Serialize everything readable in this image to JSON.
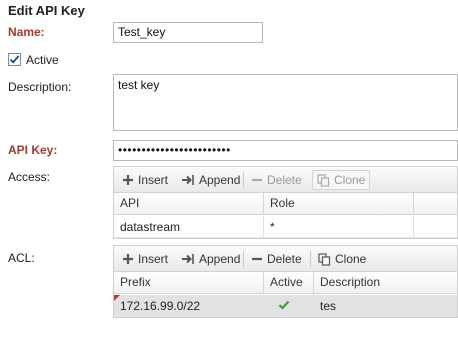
{
  "page": {
    "title": "Edit API Key"
  },
  "form": {
    "name_label": "Name:",
    "name_value": "Test_key",
    "active_label": "Active",
    "active_checked": true,
    "description_label": "Description:",
    "description_value": "test key",
    "api_key_label": "API Key:",
    "api_key_value": "••••••••••••••••••••••••",
    "access_label": "Access:",
    "acl_label": "ACL:"
  },
  "access_grid": {
    "toolbar": {
      "insert": "Insert",
      "append": "Append",
      "delete": "Delete",
      "clone": "Clone"
    },
    "columns": [
      "API",
      "Role"
    ],
    "rows": [
      {
        "api": "datastream",
        "role": "*"
      }
    ]
  },
  "acl_grid": {
    "toolbar": {
      "insert": "Insert",
      "append": "Append",
      "delete": "Delete",
      "clone": "Clone"
    },
    "columns": [
      "Prefix",
      "Active",
      "Description"
    ],
    "rows": [
      {
        "prefix": "172.16.99.0/22",
        "active": true,
        "description": "tes",
        "selected": true,
        "modified": true
      }
    ]
  },
  "colors": {
    "required_label": "#a33a2a",
    "active_check": "#3aa335",
    "dirty_marker": "#c0392b"
  },
  "icons": {
    "insert": "plus-icon",
    "append": "append-arrow-icon",
    "delete": "minus-icon",
    "clone": "clone-icon",
    "active": "checkmark-icon"
  }
}
